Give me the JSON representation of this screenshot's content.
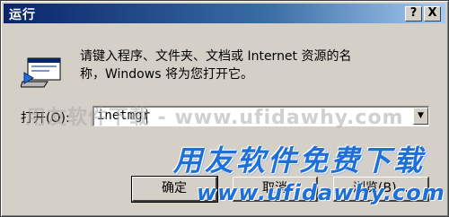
{
  "window": {
    "title": "运行",
    "help_label": "?",
    "close_label": "X"
  },
  "description": {
    "line1": "请键入程序、文件夹、文档或 Internet 资源的名",
    "line2": "称，Windows 将为您打开它。"
  },
  "open_field": {
    "label": "打开(O):",
    "value": "inetmgr"
  },
  "buttons": {
    "ok": "确定",
    "cancel": "取消",
    "browse": "浏览(B)..."
  },
  "watermark": {
    "line1": "用友软件下载 - www.ufidawhy.com",
    "line2": "用友软件免费下载",
    "line3": "www.ufidawhy.com"
  },
  "icons": {
    "run": "run-icon",
    "dropdown": "chevron-down-icon"
  },
  "colors": {
    "titlebar_start": "#0a246a",
    "titlebar_end": "#a6caf0",
    "dialog_face": "#d4d0c8",
    "watermark_blue": "#1e6fd8"
  }
}
